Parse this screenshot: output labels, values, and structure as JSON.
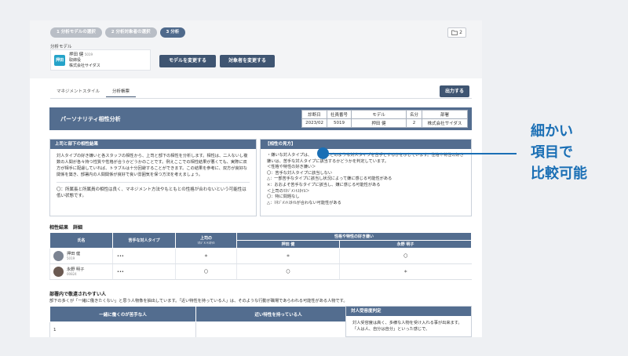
{
  "steps": [
    "1 分析モデルの選択",
    "2 分析対象者の選択",
    "3 分析"
  ],
  "folder_count": "2",
  "model_label": "分析モデル",
  "model_card": {
    "logo": "押田",
    "name": "押田 健",
    "id": "5019",
    "role": "取締役",
    "company": "株式会社サイダス"
  },
  "buttons": {
    "change_model": "モデルを変更する",
    "change_target": "対象者を変更する",
    "print": "出力する"
  },
  "tabs": [
    "マネジメントスタイル",
    "分析帳票"
  ],
  "report": {
    "title": "パーソナリティ相性分析",
    "info_headers": [
      "診断日",
      "社員番号",
      "モデル",
      "名分",
      "部署"
    ],
    "info_values": [
      "2023/02",
      "5019",
      "押田 健",
      "2",
      "株式会社サイダス"
    ]
  },
  "left_box": {
    "title": "上司と部下の相性結果",
    "text": "対人タイプの好き嫌いと各スタッフの相性から、上司と部下の相性を分析します。相性は、二人ないし複数の人間が各々持つ性質や性格が合うかどうかのことです。例えここでの相性結果が悪くても、実際に双方が相手に配慮していれば、トラブルは十分回避することができます。この結果を参考に、双方が良好な関係を築き、部署内の人間関係が良好で良い雰囲気を保つ方法を考えましょう。",
    "note": "〇：所属長と所属員の相性は良く、マネジメント方法やもともとの性格が合わないという可能性は低い状態です。"
  },
  "right_box": {
    "title": "【相性の見方】",
    "lines": [
      "・嫌いな対人タイプは、　　自身にどのような対人タイプを苦手とするかを示しています。性格や特性の好き嫌いは、苦手な対人タイプに該当するかどうかを判定しています。",
      "＜性格や特性の好き嫌い＞",
      "〇：苦手な対人タイプに該当しない",
      "△：一部苦手なタイプに該当し状況によって嫌に感じる可能性がある",
      "×：おおよそ苦手なタイプに該当し、嫌に感じる可能性がある",
      "＜上司のﾏﾈｼﾞﾒﾝﾄｽﾀｲﾙ＞",
      "〇：特に問題なし",
      "△：ﾏﾈｼﾞﾒﾝﾄｽﾀｲﾙが合わない可能性がある"
    ]
  },
  "results": {
    "title": "相性結果　詳細",
    "headers": {
      "name": "氏名",
      "dislike": "苦手な対人タイプ",
      "boss_line1": "上司の",
      "boss_line2": "ﾏﾈｼﾞﾒﾝﾄｽﾀｲﾙ",
      "likes": "性格や特性の好き嫌い",
      "p1": "押田 健",
      "p2": "永野 明子"
    },
    "rows": [
      {
        "name": "押田 健",
        "id": "5019",
        "dislike": "•••",
        "boss": "＊",
        "c1": "＊",
        "c2": "〇"
      },
      {
        "name": "永野 明子",
        "id": "00824",
        "dislike": "•••",
        "boss": "〇",
        "c1": "〇",
        "c2": "＊"
      }
    ]
  },
  "workplace": {
    "title": "部署内で敬遠されやすい人",
    "desc": "部下の多くが「一緒に働きたくない」と思う人物像を抽出しています。「近い特性を持っている人」は、そのような行動が職場であらわれる可能性がある人物です。",
    "col1": "一緒に働くのが苦手な人",
    "col2": "近い特性を持っている人",
    "row_no": "1"
  },
  "tolerance": {
    "title": "対人受容度判定",
    "text": "対人受容度は高く、多様な人物を受け入れる事が出来ます。「人は人、自分は自分」といった感じで、"
  },
  "callout": [
    "細かい",
    "項目で",
    "比較可能"
  ],
  "colors": {
    "accent": "#536d8f",
    "callout": "#1a6fb5"
  }
}
